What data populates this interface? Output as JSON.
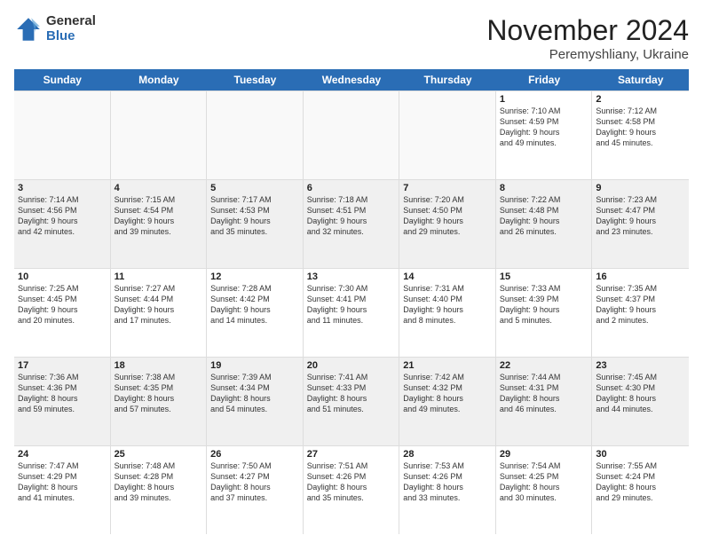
{
  "logo": {
    "general": "General",
    "blue": "Blue"
  },
  "title": "November 2024",
  "location": "Peremyshliany, Ukraine",
  "days_of_week": [
    "Sunday",
    "Monday",
    "Tuesday",
    "Wednesday",
    "Thursday",
    "Friday",
    "Saturday"
  ],
  "rows": [
    [
      {
        "day": "",
        "info": "",
        "empty": true
      },
      {
        "day": "",
        "info": "",
        "empty": true
      },
      {
        "day": "",
        "info": "",
        "empty": true
      },
      {
        "day": "",
        "info": "",
        "empty": true
      },
      {
        "day": "",
        "info": "",
        "empty": true
      },
      {
        "day": "1",
        "info": "Sunrise: 7:10 AM\nSunset: 4:59 PM\nDaylight: 9 hours\nand 49 minutes.",
        "empty": false
      },
      {
        "day": "2",
        "info": "Sunrise: 7:12 AM\nSunset: 4:58 PM\nDaylight: 9 hours\nand 45 minutes.",
        "empty": false
      }
    ],
    [
      {
        "day": "3",
        "info": "Sunrise: 7:14 AM\nSunset: 4:56 PM\nDaylight: 9 hours\nand 42 minutes.",
        "empty": false
      },
      {
        "day": "4",
        "info": "Sunrise: 7:15 AM\nSunset: 4:54 PM\nDaylight: 9 hours\nand 39 minutes.",
        "empty": false
      },
      {
        "day": "5",
        "info": "Sunrise: 7:17 AM\nSunset: 4:53 PM\nDaylight: 9 hours\nand 35 minutes.",
        "empty": false
      },
      {
        "day": "6",
        "info": "Sunrise: 7:18 AM\nSunset: 4:51 PM\nDaylight: 9 hours\nand 32 minutes.",
        "empty": false
      },
      {
        "day": "7",
        "info": "Sunrise: 7:20 AM\nSunset: 4:50 PM\nDaylight: 9 hours\nand 29 minutes.",
        "empty": false
      },
      {
        "day": "8",
        "info": "Sunrise: 7:22 AM\nSunset: 4:48 PM\nDaylight: 9 hours\nand 26 minutes.",
        "empty": false
      },
      {
        "day": "9",
        "info": "Sunrise: 7:23 AM\nSunset: 4:47 PM\nDaylight: 9 hours\nand 23 minutes.",
        "empty": false
      }
    ],
    [
      {
        "day": "10",
        "info": "Sunrise: 7:25 AM\nSunset: 4:45 PM\nDaylight: 9 hours\nand 20 minutes.",
        "empty": false
      },
      {
        "day": "11",
        "info": "Sunrise: 7:27 AM\nSunset: 4:44 PM\nDaylight: 9 hours\nand 17 minutes.",
        "empty": false
      },
      {
        "day": "12",
        "info": "Sunrise: 7:28 AM\nSunset: 4:42 PM\nDaylight: 9 hours\nand 14 minutes.",
        "empty": false
      },
      {
        "day": "13",
        "info": "Sunrise: 7:30 AM\nSunset: 4:41 PM\nDaylight: 9 hours\nand 11 minutes.",
        "empty": false
      },
      {
        "day": "14",
        "info": "Sunrise: 7:31 AM\nSunset: 4:40 PM\nDaylight: 9 hours\nand 8 minutes.",
        "empty": false
      },
      {
        "day": "15",
        "info": "Sunrise: 7:33 AM\nSunset: 4:39 PM\nDaylight: 9 hours\nand 5 minutes.",
        "empty": false
      },
      {
        "day": "16",
        "info": "Sunrise: 7:35 AM\nSunset: 4:37 PM\nDaylight: 9 hours\nand 2 minutes.",
        "empty": false
      }
    ],
    [
      {
        "day": "17",
        "info": "Sunrise: 7:36 AM\nSunset: 4:36 PM\nDaylight: 8 hours\nand 59 minutes.",
        "empty": false
      },
      {
        "day": "18",
        "info": "Sunrise: 7:38 AM\nSunset: 4:35 PM\nDaylight: 8 hours\nand 57 minutes.",
        "empty": false
      },
      {
        "day": "19",
        "info": "Sunrise: 7:39 AM\nSunset: 4:34 PM\nDaylight: 8 hours\nand 54 minutes.",
        "empty": false
      },
      {
        "day": "20",
        "info": "Sunrise: 7:41 AM\nSunset: 4:33 PM\nDaylight: 8 hours\nand 51 minutes.",
        "empty": false
      },
      {
        "day": "21",
        "info": "Sunrise: 7:42 AM\nSunset: 4:32 PM\nDaylight: 8 hours\nand 49 minutes.",
        "empty": false
      },
      {
        "day": "22",
        "info": "Sunrise: 7:44 AM\nSunset: 4:31 PM\nDaylight: 8 hours\nand 46 minutes.",
        "empty": false
      },
      {
        "day": "23",
        "info": "Sunrise: 7:45 AM\nSunset: 4:30 PM\nDaylight: 8 hours\nand 44 minutes.",
        "empty": false
      }
    ],
    [
      {
        "day": "24",
        "info": "Sunrise: 7:47 AM\nSunset: 4:29 PM\nDaylight: 8 hours\nand 41 minutes.",
        "empty": false
      },
      {
        "day": "25",
        "info": "Sunrise: 7:48 AM\nSunset: 4:28 PM\nDaylight: 8 hours\nand 39 minutes.",
        "empty": false
      },
      {
        "day": "26",
        "info": "Sunrise: 7:50 AM\nSunset: 4:27 PM\nDaylight: 8 hours\nand 37 minutes.",
        "empty": false
      },
      {
        "day": "27",
        "info": "Sunrise: 7:51 AM\nSunset: 4:26 PM\nDaylight: 8 hours\nand 35 minutes.",
        "empty": false
      },
      {
        "day": "28",
        "info": "Sunrise: 7:53 AM\nSunset: 4:26 PM\nDaylight: 8 hours\nand 33 minutes.",
        "empty": false
      },
      {
        "day": "29",
        "info": "Sunrise: 7:54 AM\nSunset: 4:25 PM\nDaylight: 8 hours\nand 30 minutes.",
        "empty": false
      },
      {
        "day": "30",
        "info": "Sunrise: 7:55 AM\nSunset: 4:24 PM\nDaylight: 8 hours\nand 29 minutes.",
        "empty": false
      }
    ]
  ]
}
